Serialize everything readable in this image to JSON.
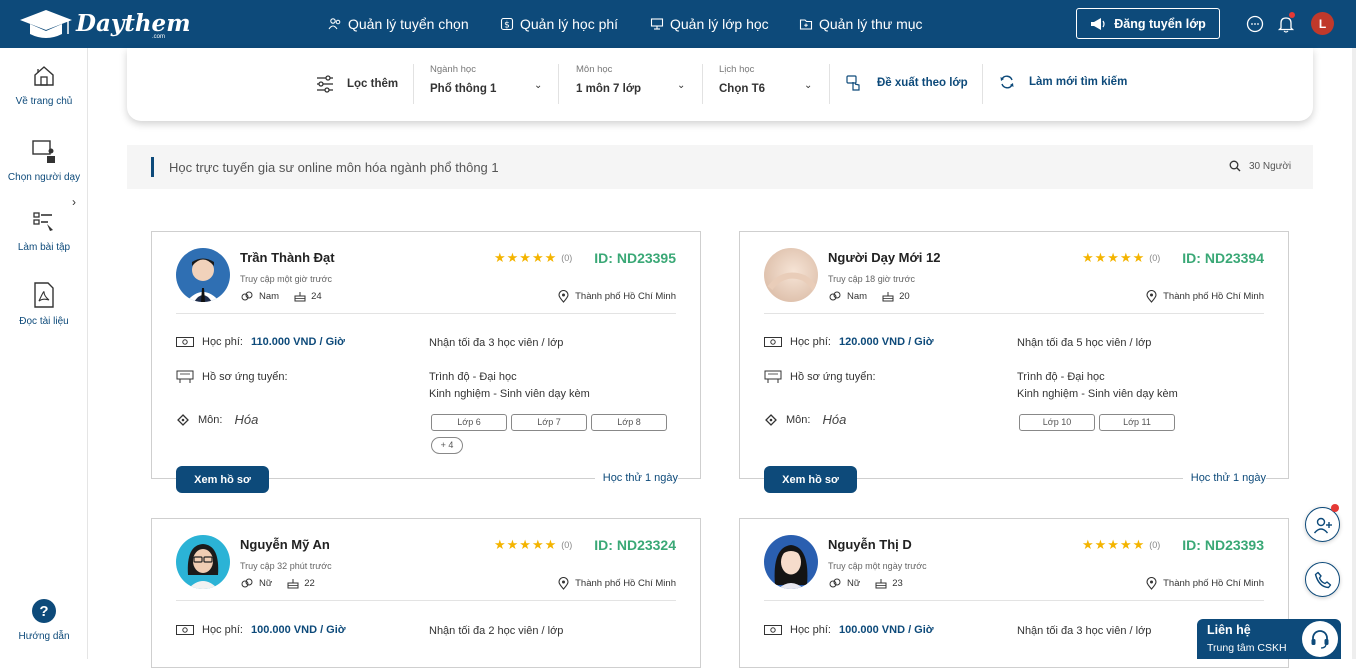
{
  "header": {
    "logo_text": "Daythem",
    "logo_sub": ".com",
    "nav": [
      {
        "label": "Quản lý tuyển chọn",
        "icon": "people-icon"
      },
      {
        "label": "Quản lý học phí",
        "icon": "money-icon"
      },
      {
        "label": "Quản lý lớp học",
        "icon": "classroom-icon"
      },
      {
        "label": "Quản lý thư mục",
        "icon": "folder-icon"
      }
    ],
    "post_button": "Đăng tuyển lớp",
    "user_initial": "L"
  },
  "sidebar": {
    "items": [
      {
        "label": "Về trang chủ",
        "icon": "home-icon"
      },
      {
        "label": "Chọn người dạy",
        "icon": "teacher-icon"
      },
      {
        "label": "Làm bài tập",
        "icon": "exercise-icon"
      },
      {
        "label": "Đọc tài liệu",
        "icon": "pdf-icon"
      }
    ],
    "help_label": "Hướng dẫn"
  },
  "filter": {
    "more_label": "Lọc thêm",
    "major": {
      "label": "Ngành học",
      "value": "Phổ thông 1"
    },
    "subject": {
      "label": "Môn học",
      "value": "1 môn 7 lớp"
    },
    "schedule": {
      "label": "Lịch học",
      "value": "Chọn T6"
    },
    "suggest_label": "Đề xuất theo lớp",
    "refresh_label": "Làm mới tìm kiếm"
  },
  "search": {
    "query": "Học trực tuyến gia sư online môn hóa ngành phổ thông 1",
    "count": "30 Người"
  },
  "labels": {
    "fee": "Học phí:",
    "profile": "Hồ sơ ứng tuyển:",
    "subject": "Môn:",
    "view": "Xem hồ sơ"
  },
  "tutors": [
    {
      "name": "Trần Thành Đạt",
      "access": "Truy cập một giờ trước",
      "gender": "Nam",
      "age": "24",
      "stars": "★★★★★",
      "reviews": "(0)",
      "id": "ID: ND23395",
      "location": "Thành phố Hồ Chí Minh",
      "fee": "110.000 VND / Giờ",
      "capacity": "Nhận tối đa 3 học viên / lớp",
      "level": "Trình độ - Đại học",
      "experience": "Kinh nghiệm - Sinh viên dạy kèm",
      "subject": "Hóa",
      "classes": [
        "Lớp 6",
        "Lớp 7",
        "Lớp 8"
      ],
      "more": "+ 4",
      "trial": "Học thử 1 ngày"
    },
    {
      "name": "Người Dạy Mới 12",
      "access": "Truy cập 18 giờ trước",
      "gender": "Nam",
      "age": "20",
      "stars": "★★★★★",
      "reviews": "(0)",
      "id": "ID: ND23394",
      "location": "Thành phố Hồ Chí Minh",
      "fee": "120.000 VND / Giờ",
      "capacity": "Nhận tối đa 5 học viên / lớp",
      "level": "Trình độ - Đại học",
      "experience": "Kinh nghiệm - Sinh viên dạy kèm",
      "subject": "Hóa",
      "classes": [
        "Lớp 10",
        "Lớp 11"
      ],
      "more": "",
      "trial": "Học thử 1 ngày"
    },
    {
      "name": "Nguyễn Mỹ An",
      "access": "Truy cập 32 phút trước",
      "gender": "Nữ",
      "age": "22",
      "stars": "★★★★★",
      "reviews": "(0)",
      "id": "ID: ND23324",
      "location": "Thành phố Hồ Chí Minh",
      "fee": "100.000 VND / Giờ",
      "capacity": "Nhận tối đa 2 học viên / lớp"
    },
    {
      "name": "Nguyễn Thị D",
      "access": "Truy cập một ngày trước",
      "gender": "Nữ",
      "age": "23",
      "stars": "★★★★★",
      "reviews": "(0)",
      "id": "ID: ND23393",
      "location": "Thành phố Hồ Chí Minh",
      "fee": "100.000 VND / Giờ",
      "capacity": "Nhận tối đa 3 học viên / lớp"
    }
  ],
  "contact": {
    "title": "Liên hệ",
    "subtitle": "Trung tâm CSKH"
  },
  "colors": {
    "brand": "#0d4a7a",
    "id_green": "#3aa876",
    "star": "#f4b400",
    "alert": "#e53935"
  }
}
